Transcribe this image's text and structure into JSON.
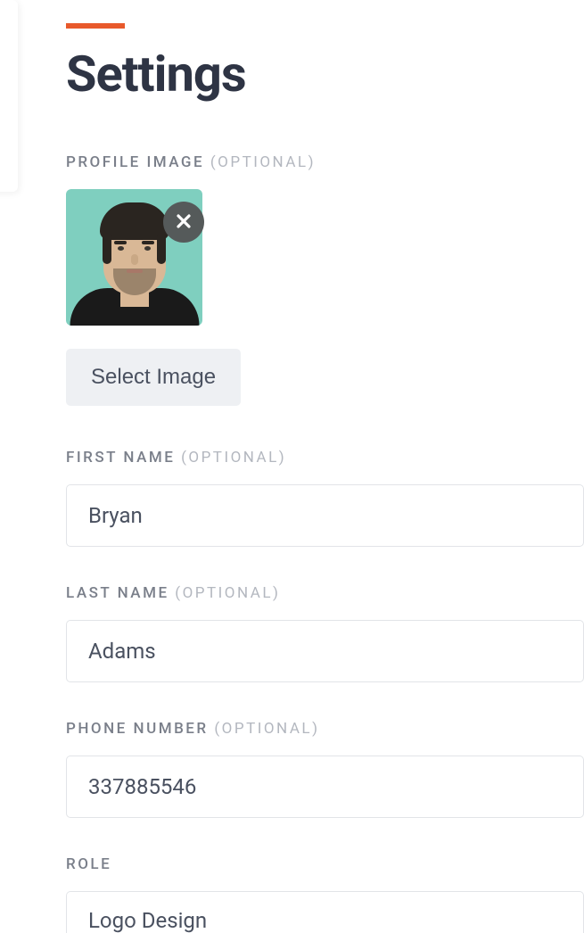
{
  "page": {
    "title": "Settings"
  },
  "profile_image": {
    "label": "PROFILE IMAGE",
    "optional_suffix": "(OPTIONAL)",
    "select_button_label": "Select Image"
  },
  "fields": {
    "first_name": {
      "label": "FIRST NAME",
      "optional_suffix": "(OPTIONAL)",
      "value": "Bryan"
    },
    "last_name": {
      "label": "LAST NAME",
      "optional_suffix": "(OPTIONAL)",
      "value": "Adams"
    },
    "phone_number": {
      "label": "PHONE NUMBER",
      "optional_suffix": "(OPTIONAL)",
      "value": "337885546"
    },
    "role": {
      "label": "ROLE",
      "value": "Logo Design"
    }
  },
  "colors": {
    "accent": "#e8592b",
    "heading": "#2e3444",
    "label": "#7a7f8a",
    "label_optional": "#b3b7bf",
    "input_text": "#4a5160",
    "border": "#e2e4e8",
    "button_bg": "#eef0f3"
  }
}
